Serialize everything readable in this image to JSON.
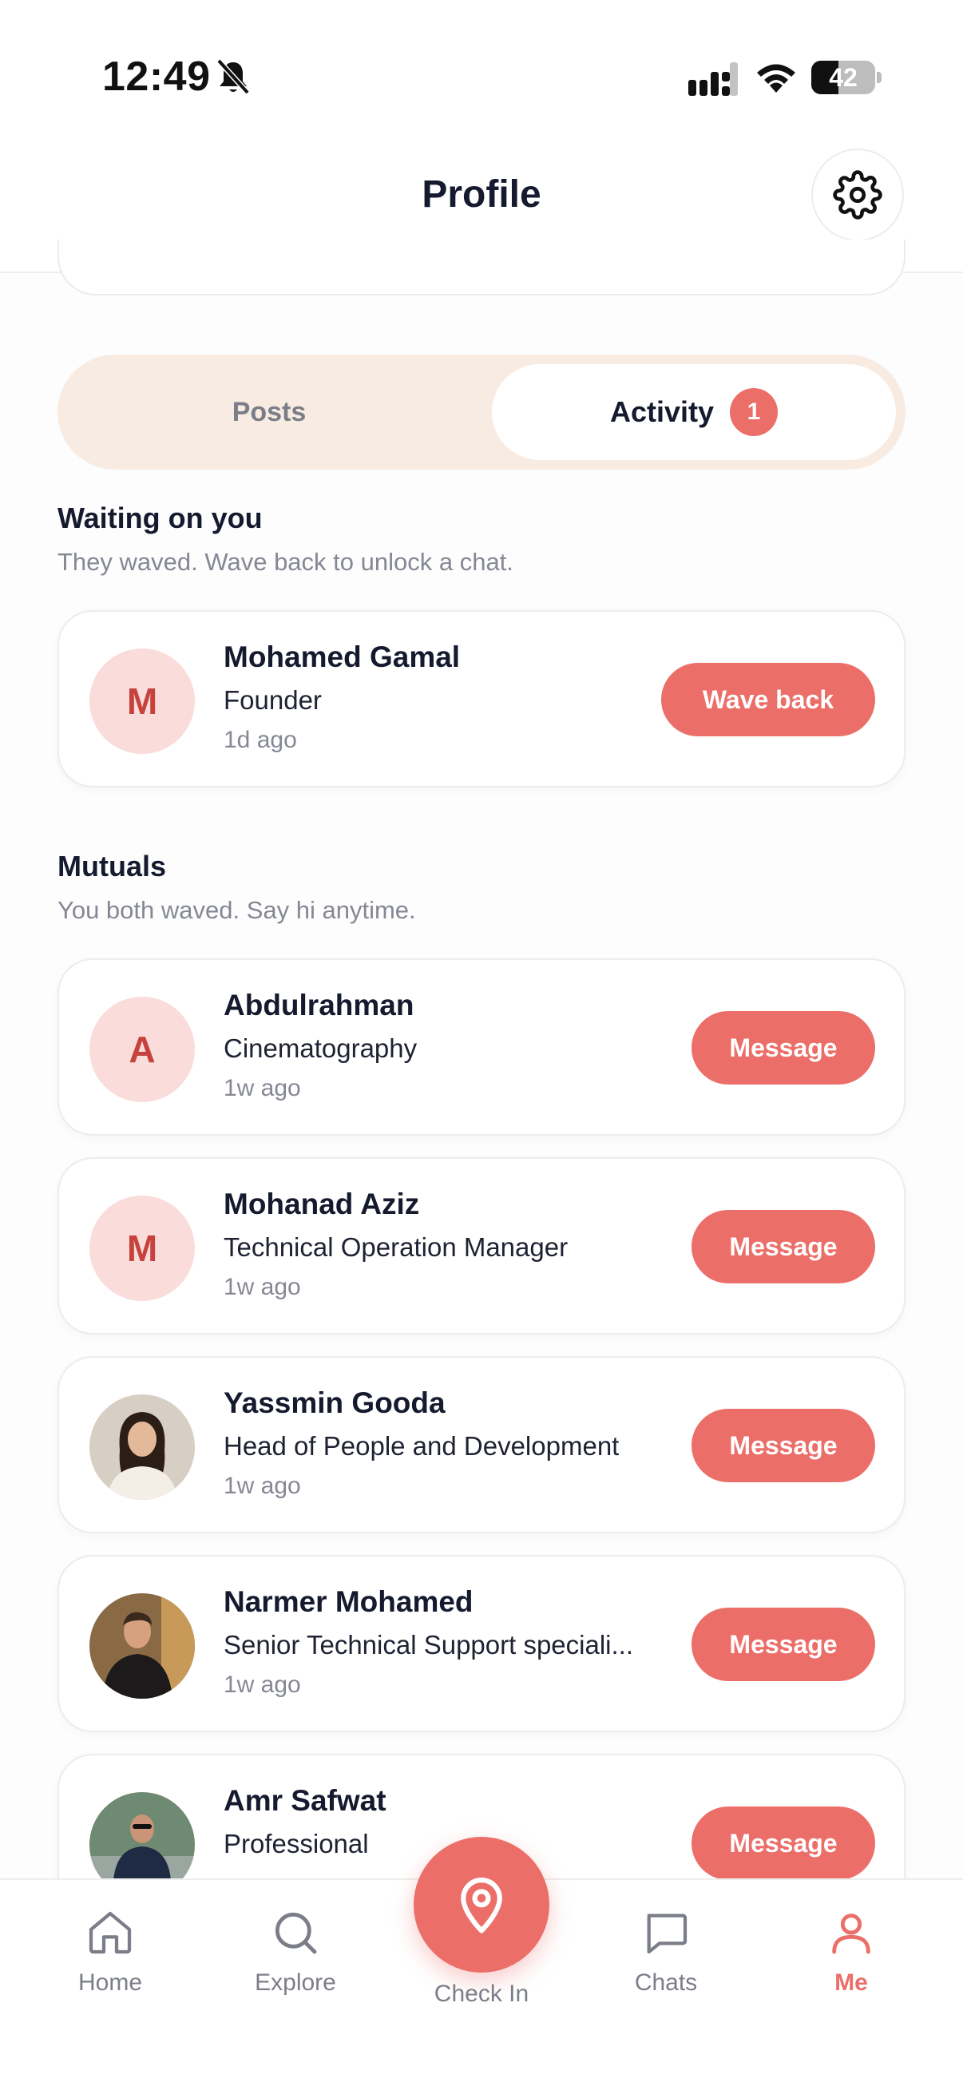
{
  "status_bar": {
    "time": "12:49",
    "battery": "42",
    "battery_level": 0.42
  },
  "header": {
    "title": "Profile"
  },
  "tabs": [
    {
      "label": "Posts",
      "active": false
    },
    {
      "label": "Activity",
      "active": true,
      "badge": "1"
    }
  ],
  "waiting": {
    "title": "Waiting on you",
    "subtitle": "They waved. Wave back to unlock a chat.",
    "items": [
      {
        "initial": "M",
        "name": "Mohamed Gamal",
        "role": "Founder",
        "time": "1d ago",
        "action": "Wave back"
      }
    ]
  },
  "mutuals": {
    "title": "Mutuals",
    "subtitle": "You both waved. Say hi anytime.",
    "items": [
      {
        "initial": "A",
        "name": "Abdulrahman",
        "role": "Cinematography",
        "time": "1w ago",
        "action": "Message"
      },
      {
        "initial": "M",
        "name": "Mohanad Aziz",
        "role": "Technical Operation Manager",
        "time": "1w ago",
        "action": "Message"
      },
      {
        "name": "Yassmin Gooda",
        "role": "Head of People and Development",
        "time": "1w ago",
        "action": "Message"
      },
      {
        "name": "Narmer Mohamed",
        "role": "Senior Technical Support speciali...",
        "time": "1w ago",
        "action": "Message"
      },
      {
        "name": "Amr Safwat",
        "role": "Professional",
        "action": "Message"
      }
    ]
  },
  "nav": {
    "items": [
      {
        "label": "Home",
        "icon": "home-icon"
      },
      {
        "label": "Explore",
        "icon": "search-icon"
      },
      {
        "label": "Check In",
        "icon": "location-pin-icon"
      },
      {
        "label": "Chats",
        "icon": "chat-icon"
      },
      {
        "label": "Me",
        "icon": "user-icon",
        "active": true
      }
    ]
  },
  "colors": {
    "accent": "#ec6e69",
    "tab_bg": "#f8ebe2",
    "avatar_bg": "#fadcda"
  }
}
